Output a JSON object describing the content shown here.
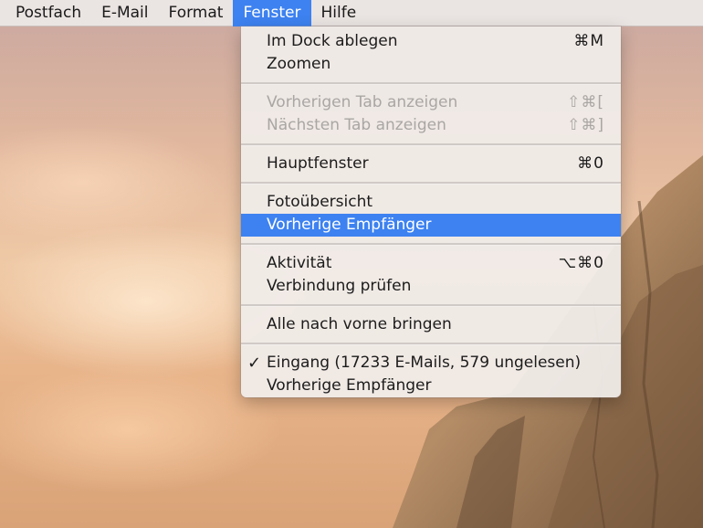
{
  "menubar": {
    "items": [
      {
        "label": "Postfach"
      },
      {
        "label": "E-Mail"
      },
      {
        "label": "Format"
      },
      {
        "label": "Fenster",
        "active": true
      },
      {
        "label": "Hilfe"
      }
    ]
  },
  "window_menu": {
    "groups": [
      [
        {
          "label": "Im Dock ablegen",
          "shortcut": "⌘M"
        },
        {
          "label": "Zoomen",
          "shortcut": ""
        }
      ],
      [
        {
          "label": "Vorherigen Tab anzeigen",
          "shortcut": "⇧⌘[",
          "disabled": true
        },
        {
          "label": "Nächsten Tab anzeigen",
          "shortcut": "⇧⌘]",
          "disabled": true
        }
      ],
      [
        {
          "label": "Hauptfenster",
          "shortcut": "⌘0"
        }
      ],
      [
        {
          "label": "Fotoübersicht",
          "shortcut": ""
        },
        {
          "label": "Vorherige Empfänger",
          "shortcut": "",
          "highlighted": true
        }
      ],
      [
        {
          "label": "Aktivität",
          "shortcut": "⌥⌘0"
        },
        {
          "label": "Verbindung prüfen",
          "shortcut": ""
        }
      ],
      [
        {
          "label": "Alle nach vorne bringen",
          "shortcut": ""
        }
      ],
      [
        {
          "label": "Eingang (17233 E-Mails, 579 ungelesen)",
          "shortcut": "",
          "checked": true,
          "check_mark": "✓"
        },
        {
          "label": "Vorherige Empfänger",
          "shortcut": ""
        }
      ]
    ]
  },
  "colors": {
    "highlight": "#3d82f0",
    "menu_background": "#f0ece9",
    "disabled_text": "#a9a6a4"
  }
}
